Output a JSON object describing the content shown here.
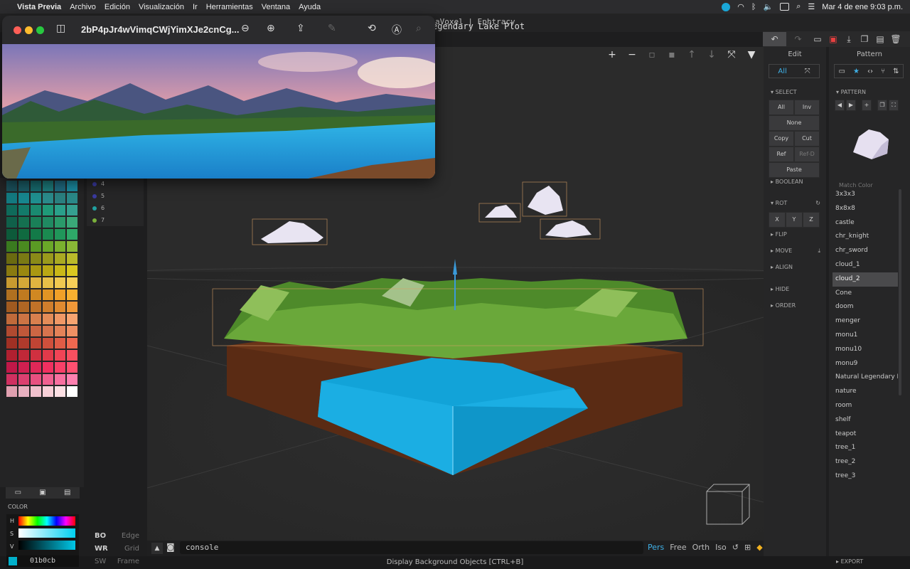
{
  "menubar": {
    "app": "Vista Previa",
    "items": [
      "Archivo",
      "Edición",
      "Visualización",
      "Ir",
      "Herramientas",
      "Ventana",
      "Ayuda"
    ],
    "clock": "Mar 4 de ene  9:03 p.m."
  },
  "window": {
    "title": "aVoxel | Ephtracy",
    "document": "egendary Lake Plot"
  },
  "preview": {
    "filename": "2bP4pJr4wVimqCWjYimXJe2cnCg..."
  },
  "layers": [
    {
      "num": "4",
      "color": "#3a3aa0"
    },
    {
      "num": "5",
      "color": "#3a3aa0"
    },
    {
      "num": "6",
      "color": "#20a0a0"
    },
    {
      "num": "7",
      "color": "#7ab03a"
    }
  ],
  "palette": {
    "colors": [
      "#1a4f5a",
      "#1a5a64",
      "#176a6e",
      "#1c7a7a",
      "#1f6a80",
      "#1a8aa0",
      "#137a80",
      "#17868e",
      "#1f8f8f",
      "#2a8a8a",
      "#2a7f7f",
      "#2a8888",
      "#0f6a5a",
      "#137a6a",
      "#1a8a70",
      "#1f9a78",
      "#2aa08a",
      "#35a090",
      "#10604a",
      "#157050",
      "#1a8058",
      "#208a62",
      "#2a9a6a",
      "#3aa878",
      "#0d5a3a",
      "#106a40",
      "#137a48",
      "#1a8a50",
      "#20965a",
      "#2ea868",
      "#3a7a1f",
      "#4a8a20",
      "#5a9a24",
      "#6aa828",
      "#7ab02e",
      "#8ab836",
      "#6a6a10",
      "#7a7a14",
      "#8a8a18",
      "#9a9a1c",
      "#aaaa22",
      "#baba2a",
      "#8a7a10",
      "#9a8810",
      "#aa9812",
      "#baa814",
      "#cab818",
      "#dac820",
      "#c89a30",
      "#d4a838",
      "#e0b440",
      "#e8c048",
      "#f0c850",
      "#f8d058",
      "#b07020",
      "#c07a20",
      "#d08822",
      "#e09424",
      "#f0a028",
      "#f8b030",
      "#a05a20",
      "#b06624",
      "#c07228",
      "#d07e2c",
      "#e08a30",
      "#f09838",
      "#c06a3a",
      "#cc7444",
      "#d8804e",
      "#e48c58",
      "#f09866",
      "#f8a470",
      "#b04a30",
      "#c0583a",
      "#cc6644",
      "#d8744e",
      "#e48258",
      "#f09064",
      "#a03024",
      "#b03a2c",
      "#c04434",
      "#d0503c",
      "#e05c46",
      "#f06850",
      "#b02030",
      "#c02838",
      "#d03040",
      "#e03a4a",
      "#f04456",
      "#f85060",
      "#c01848",
      "#d02050",
      "#e02858",
      "#f03060",
      "#f84068",
      "#ff5070",
      "#d03060",
      "#dc4070",
      "#e85080",
      "#f06090",
      "#f870a0",
      "#ff80b0",
      "#e0a0b0",
      "#e8b0c0",
      "#f0c0cc",
      "#f8d0d8",
      "#fce0e4",
      "#ffffff"
    ],
    "hex": "01b0cb",
    "color_label": "COLOR"
  },
  "modes": {
    "bo": "BO",
    "edge": "Edge",
    "wr": "WR",
    "grid": "Grid",
    "sw": "SW",
    "frame": "Frame"
  },
  "viewport": {
    "console": "console",
    "views": [
      "Pers",
      "Free",
      "Orth",
      "Iso"
    ],
    "status": "Display Background Objects [CTRL+B]"
  },
  "edit": {
    "title": "Edit",
    "all": "All",
    "select": "SELECT",
    "sel_all": "All",
    "inv": "Inv",
    "none": "None",
    "copy": "Copy",
    "cut": "Cut",
    "ref": "Ref",
    "refd": "Ref-D",
    "paste": "Paste",
    "boolean": "BOOLEAN",
    "rot": "ROT",
    "x": "X",
    "y": "Y",
    "z": "Z",
    "flip": "FLIP",
    "move": "MOVE",
    "align": "ALIGN",
    "hide": "HIDE",
    "order": "ORDER"
  },
  "pattern": {
    "title": "Pattern",
    "section": "PATTERN",
    "match_color": "Match Color",
    "items": [
      "3x3x3",
      "8x8x8",
      "castle",
      "chr_knight",
      "chr_sword",
      "cloud_1",
      "cloud_2",
      "Cone",
      "doom",
      "menger",
      "monu1",
      "monu10",
      "monu9",
      "Natural Legendary L",
      "nature",
      "room",
      "shelf",
      "teapot",
      "tree_1",
      "tree_2",
      "tree_3"
    ],
    "selected": "cloud_2",
    "export": "EXPORT"
  }
}
